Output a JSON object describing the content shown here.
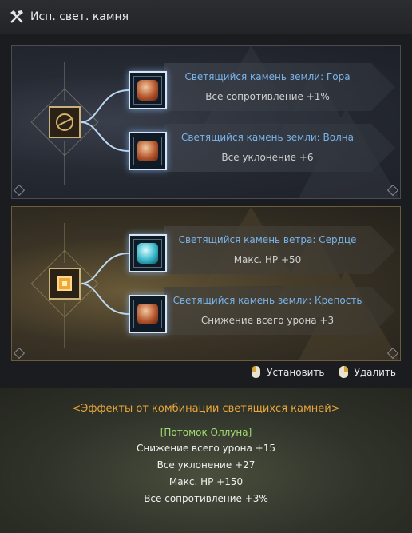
{
  "window": {
    "title": "Исп. свет. камня",
    "icon": "crossed-tools-icon"
  },
  "groups": [
    {
      "hub_icon": "ring-emblem-icon",
      "stones": [
        {
          "name": "Светящийся камень земли: Гора",
          "effect": "Все сопротивление +1%",
          "gem": "earth-gem-icon"
        },
        {
          "name": "Светящийся камень земли: Волна",
          "effect": "Все уклонение +6",
          "gem": "earth-gem-icon"
        }
      ]
    },
    {
      "hub_icon": "amber-core-icon",
      "stones": [
        {
          "name": "Светящийся камень ветра: Сердце",
          "effect": "Макс. HP +50",
          "gem": "wind-gem-icon"
        },
        {
          "name": "Светящийся камень земли: Крепость",
          "effect": "Снижение всего урона +3",
          "gem": "earth-gem-icon"
        }
      ]
    }
  ],
  "actions": {
    "install_label": "Установить",
    "remove_label": "Удалить"
  },
  "combo": {
    "title": "<Эффекты от комбинации светящихся камней>",
    "set_name": "[Потомок Оллуна]",
    "lines": [
      "Снижение всего урона +15",
      "Все уклонение +27",
      "Макс. HP +150",
      "Все сопротивление +3%"
    ]
  },
  "colors": {
    "stone_name": "#79b4ea",
    "combo_title": "#e8a63b",
    "set_name": "#9fdc6f"
  }
}
